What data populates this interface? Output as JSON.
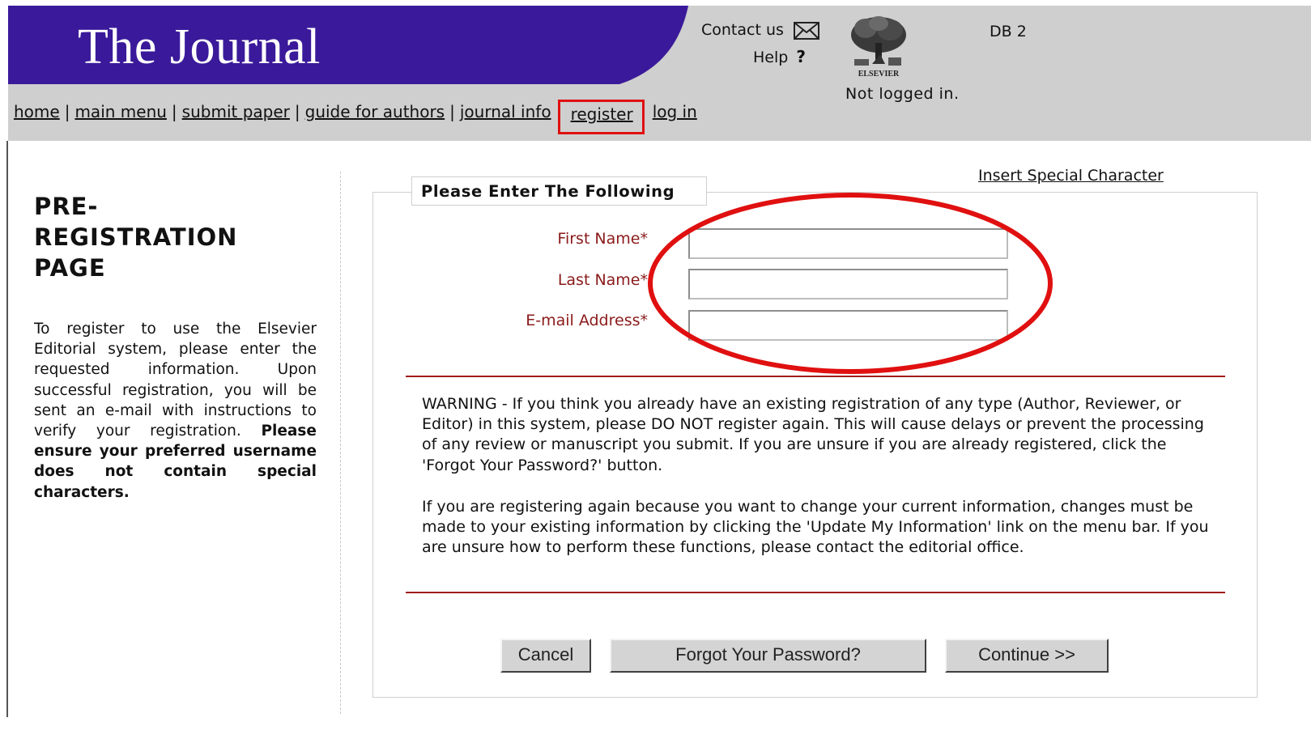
{
  "header": {
    "title": "The Journal",
    "contact_label": "Contact us",
    "help_label": "Help",
    "help_glyph": "?",
    "publisher_logo_text": "ELSEVIER",
    "db_label": "DB 2",
    "login_status": "Not logged in.",
    "banner_color": "#3a1a9a"
  },
  "nav": {
    "items": [
      "home",
      "main menu",
      "submit paper",
      "guide for authors",
      "journal info",
      "register",
      "log in"
    ],
    "separator": "|"
  },
  "sidebar": {
    "title": "PRE-\nREGISTRATION\nPAGE",
    "intro": "To register to use the Elsevier Editorial system, please enter the requested information. Upon successful registration, you will be sent an e-mail with instructions to verify your registration.",
    "intro_bold": "Please ensure your preferred username does not contain special characters."
  },
  "form": {
    "special_char_link": "Insert Special Character",
    "legend": "Please Enter The Following",
    "fields": [
      {
        "label": "First Name*",
        "value": ""
      },
      {
        "label": "Last Name*",
        "value": ""
      },
      {
        "label": "E-mail Address*",
        "value": ""
      }
    ],
    "warning_1": "WARNING - If you think you already have an existing registration of any type (Author, Reviewer, or Editor) in this system, please DO NOT register again. This will cause delays or prevent the processing of any review or manuscript you submit. If you are unsure if you are already registered, click the 'Forgot Your Password?' button.",
    "warning_2": "If you are registering again because you want to change your current information, changes must be made to your existing information by clicking the 'Update My Information' link on the menu bar. If you are unsure how to perform these functions, please contact the editorial office.",
    "buttons": {
      "cancel": "Cancel",
      "forgot": "Forgot Your Password?",
      "continue": "Continue >>"
    }
  },
  "colors": {
    "annotation": "#e01010",
    "label": "#8a1a1a",
    "rule": "#a11d1d"
  }
}
